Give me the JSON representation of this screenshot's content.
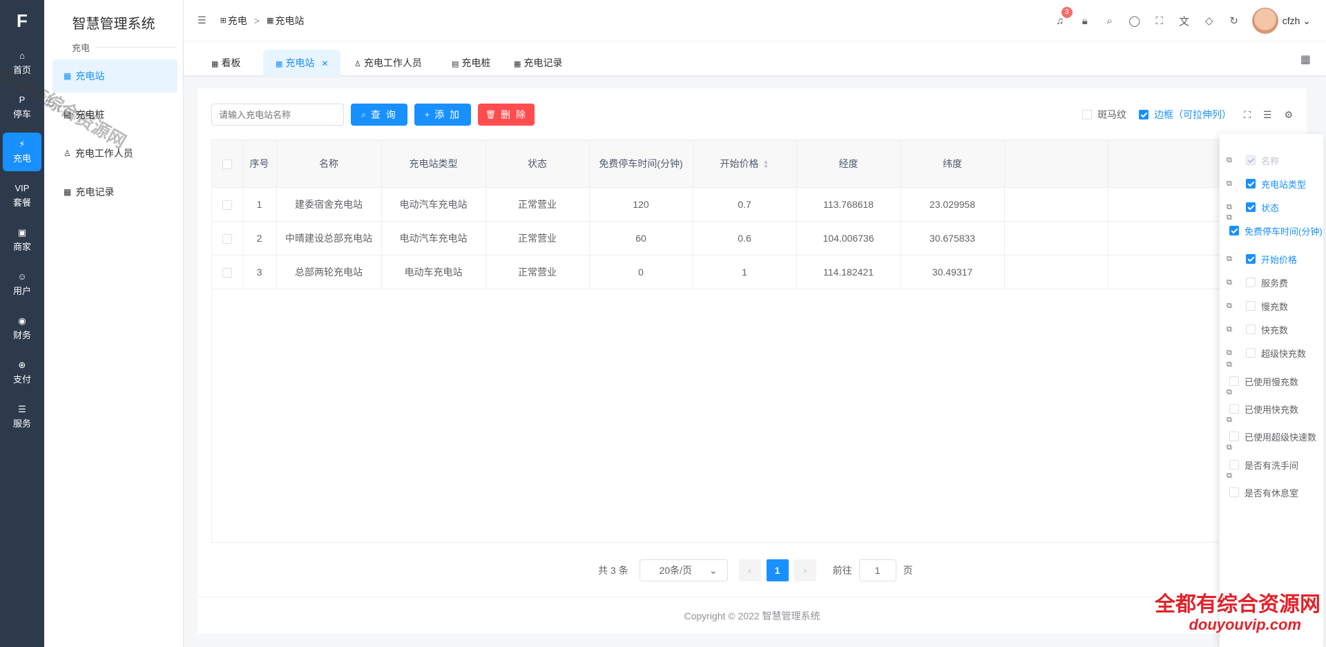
{
  "app": {
    "title": "智慧管理系统",
    "section": "充电"
  },
  "rail": [
    {
      "icon": "home-icon",
      "glyph": "⌂",
      "label": "首页",
      "active": false
    },
    {
      "icon": "parking-icon",
      "glyph": "P",
      "label": "停车",
      "active": false
    },
    {
      "icon": "charging-icon",
      "glyph": "⚡",
      "label": "充电",
      "active": true
    },
    {
      "icon": "vip-icon",
      "glyph": "VIP",
      "label": "套餐",
      "active": false
    },
    {
      "icon": "shop-icon",
      "glyph": "▣",
      "label": "商家",
      "active": false
    },
    {
      "icon": "user-icon",
      "glyph": "☺",
      "label": "用户",
      "active": false
    },
    {
      "icon": "finance-icon",
      "glyph": "◉",
      "label": "财务",
      "active": false
    },
    {
      "icon": "pay-icon",
      "glyph": "⊕",
      "label": "支付",
      "active": false
    },
    {
      "icon": "service-icon",
      "glyph": "☰",
      "label": "服务",
      "active": false
    }
  ],
  "sidebar": {
    "items": [
      {
        "label": "充电站",
        "icon": "grid-icon",
        "glyph": "▦",
        "active": true
      },
      {
        "label": "充电桩",
        "icon": "charger-icon",
        "glyph": "▤",
        "active": false
      },
      {
        "label": "充电工作人员",
        "icon": "worker-icon",
        "glyph": "♙",
        "active": false
      },
      {
        "label": "充电记录",
        "icon": "grid-icon",
        "glyph": "▦",
        "active": false
      }
    ]
  },
  "breadcrumb": [
    {
      "label": "充电",
      "glyph": "⊞"
    },
    {
      "label": "充电站",
      "glyph": "▦"
    }
  ],
  "header": {
    "notify_count": "3",
    "username": "cfzh"
  },
  "tabs": [
    {
      "label": "看板",
      "active": false
    },
    {
      "label": "充电站",
      "active": true
    },
    {
      "label": "充电工作人员",
      "active": false
    },
    {
      "label": "充电桩",
      "active": false
    },
    {
      "label": "充电记录",
      "active": false
    }
  ],
  "toolbar": {
    "search_placeholder": "请输入充电站名称",
    "query_label": "查 询",
    "add_label": "添 加",
    "delete_label": "删 除",
    "stripe_label": "斑马纹",
    "border_label": "边框（可拉伸列）"
  },
  "table": {
    "headers": [
      "序号",
      "名称",
      "充电站类型",
      "状态",
      "免费停车时间(分钟)",
      "开始价格",
      "经度",
      "纬度"
    ],
    "rows": [
      {
        "index": "1",
        "name": "建委宿舍充电站",
        "type": "电动汽车充电站",
        "status": "正常营业",
        "free_minutes": "120",
        "price": "0.7",
        "lng": "113.768618",
        "lat": "23.029958"
      },
      {
        "index": "2",
        "name": "中晴建设总部充电站",
        "type": "电动汽车充电站",
        "status": "正常营业",
        "free_minutes": "60",
        "price": "0.6",
        "lng": "104.006736",
        "lat": "30.675833"
      },
      {
        "index": "3",
        "name": "总部两轮充电站",
        "type": "电动车充电站",
        "status": "正常营业",
        "free_minutes": "0",
        "price": "1",
        "lng": "114.182421",
        "lat": "30.49317"
      }
    ]
  },
  "pagination": {
    "total": "共 3 条",
    "page_size": "20条/页",
    "current": "1",
    "goto_label": "前往",
    "goto_value": "1",
    "page_unit": "页"
  },
  "footer": {
    "copyright": "Copyright © 2022 智慧管理系统"
  },
  "column_settings": [
    {
      "label": "名称",
      "state": "disabled"
    },
    {
      "label": "充电站类型",
      "state": "on"
    },
    {
      "label": "状态",
      "state": "on"
    },
    {
      "label": "免费停车时间(分钟)",
      "state": "on"
    },
    {
      "label": "开始价格",
      "state": "on"
    },
    {
      "label": "服务费",
      "state": "off"
    },
    {
      "label": "慢充数",
      "state": "off"
    },
    {
      "label": "快充数",
      "state": "off"
    },
    {
      "label": "超级快充数",
      "state": "off"
    },
    {
      "label": "已使用慢充数",
      "state": "off"
    },
    {
      "label": "已使用快充数",
      "state": "off"
    },
    {
      "label": "已使用超级快速数",
      "state": "off"
    },
    {
      "label": "是否有洗手间",
      "state": "off"
    },
    {
      "label": "是否有休息室",
      "state": "off"
    }
  ],
  "watermark": {
    "cn": "全都有综合资源网",
    "url": "douyouvip.com"
  },
  "colors": {
    "primary": "#1890ff",
    "danger": "#ff4d4f",
    "rail_bg": "#2d3a4b"
  }
}
